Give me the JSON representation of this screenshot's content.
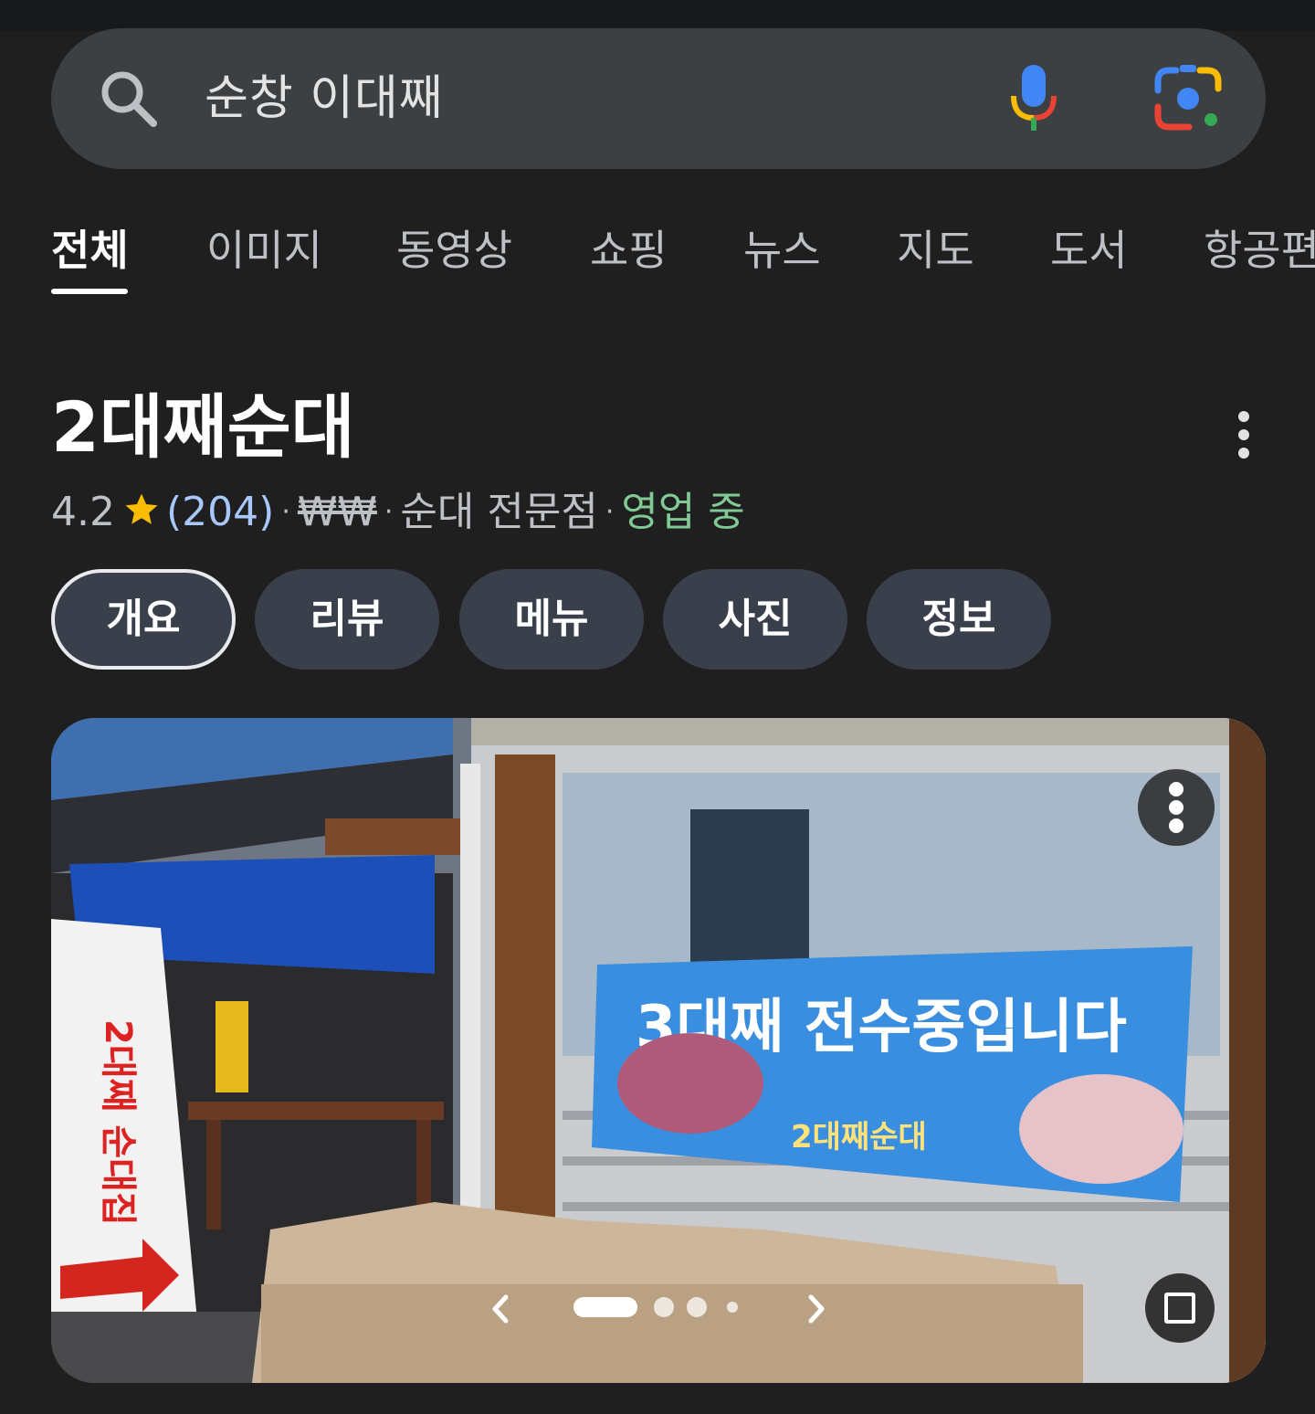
{
  "search": {
    "query": "순창 이대째",
    "icons": [
      "search-icon",
      "microphone-icon",
      "google-lens-icon"
    ]
  },
  "tabs": [
    {
      "label": "전체",
      "active": true
    },
    {
      "label": "이미지",
      "active": false
    },
    {
      "label": "동영상",
      "active": false
    },
    {
      "label": "쇼핑",
      "active": false
    },
    {
      "label": "뉴스",
      "active": false
    },
    {
      "label": "지도",
      "active": false
    },
    {
      "label": "도서",
      "active": false
    },
    {
      "label": "항공편",
      "active": false
    }
  ],
  "place": {
    "title": "2대째순대",
    "rating": "4.2",
    "reviews": "(204)",
    "price": "₩₩",
    "category": "순대 전문점",
    "status": "영업 중",
    "separator": "·"
  },
  "chips": [
    {
      "label": "개요",
      "selected": true
    },
    {
      "label": "리뷰",
      "selected": false
    },
    {
      "label": "메뉴",
      "selected": false
    },
    {
      "label": "사진",
      "selected": false
    },
    {
      "label": "정보",
      "selected": false
    }
  ],
  "photo": {
    "banner_text": "3대째 전수중입니다",
    "banner_sub": "2대째순대",
    "sign_text": "2대째 순대집",
    "page_count": 4,
    "current_page": 1
  },
  "colors": {
    "background": "#1f1f1f",
    "search_bg": "#3c4043",
    "chip_bg": "#3a3f4c",
    "link": "#a8c7fa",
    "open_green": "#81c995",
    "star": "#fbbc04"
  }
}
